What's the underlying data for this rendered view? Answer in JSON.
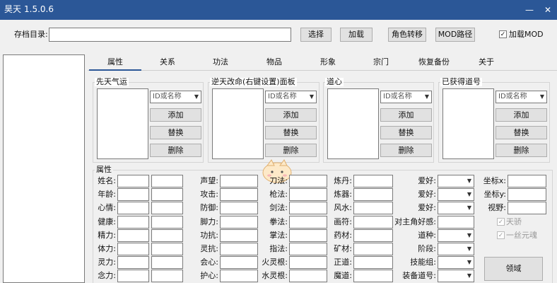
{
  "window": {
    "title": "昊天",
    "version": "1.5.0.6"
  },
  "toolbar": {
    "save_dir_label": "存档目录:",
    "save_dir_value": "",
    "select_label": "选择",
    "load_label": "加载",
    "role_transfer_label": "角色转移",
    "mod_path_label": "MOD路径",
    "load_mod_label": "加载MOD",
    "load_mod_checked": true
  },
  "tabs": [
    "属性",
    "关系",
    "功法",
    "物品",
    "形象",
    "宗门",
    "恢复备份",
    "关于"
  ],
  "groups": {
    "innate": "先天气运",
    "postnatal": "逆天改命(右键设置)面板",
    "heart": "道心",
    "titles": "已获得道号"
  },
  "group_controls": {
    "combo_placeholder": "ID或名称",
    "add": "添加",
    "replace": "替换",
    "delete": "删除"
  },
  "attr_title": "属性",
  "col1": [
    "姓名:",
    "年龄:",
    "心情:",
    "健康:",
    "精力:",
    "体力:",
    "灵力:",
    "念力:"
  ],
  "col2": [
    "声望:",
    "攻击:",
    "防御:",
    "脚力:",
    "功抗:",
    "灵抗:",
    "会心:",
    "护心:"
  ],
  "col3": [
    "刀法:",
    "枪法:",
    "剑法:",
    "拳法:",
    "掌法:",
    "指法:",
    "火灵根:",
    "水灵根:"
  ],
  "col4": [
    "炼丹:",
    "炼器:",
    "风水:",
    "画符:",
    "药材:",
    "矿材:",
    "正道:",
    "魔道:"
  ],
  "col5": [
    "爱好:",
    "爱好:",
    "爱好:",
    "对主角好感:",
    "道种:",
    "阶段:",
    "技能组:",
    "装备道号:"
  ],
  "col6": [
    "坐标x:",
    "坐标y:",
    "视野:"
  ],
  "checks": [
    {
      "label": "天骄",
      "checked": true
    },
    {
      "label": "一丝元魂",
      "checked": true
    }
  ],
  "domain_button": "领域"
}
